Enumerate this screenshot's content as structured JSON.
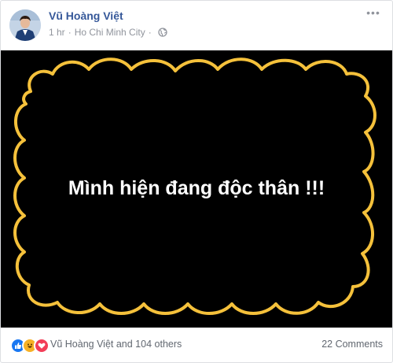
{
  "post": {
    "author": "Vũ Hoàng Việt",
    "time": "1 hr",
    "location": "Ho Chi Minh City",
    "privacy_icon": "globe-icon",
    "more_icon": "more-options-icon"
  },
  "photo": {
    "text": "Mình hiện đang độc thân !!!",
    "background_color": "#000000",
    "frame_color": "#f5c13b"
  },
  "footer": {
    "reaction_icons": [
      "like-icon",
      "haha-icon",
      "love-icon"
    ],
    "reactions_label": "Vũ Hoàng Việt and 104 others",
    "comments_label": "22 Comments"
  },
  "colors": {
    "link_blue": "#365899",
    "meta_gray": "#90949c"
  }
}
